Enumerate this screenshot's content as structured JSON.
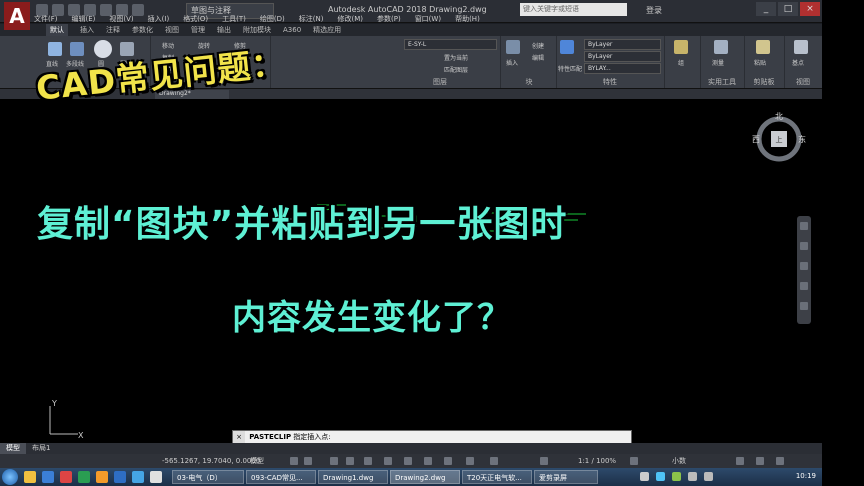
{
  "title_bar": {
    "workspace": "草图与注释",
    "title": "Autodesk AutoCAD 2018    Drawing2.dwg",
    "search_placeholder": "键入关键字或短语",
    "login": "登录",
    "min": "_",
    "max": "□",
    "close": "×",
    "logo": "A"
  },
  "menu": [
    "文件(F)",
    "编辑(E)",
    "视图(V)",
    "插入(I)",
    "格式(O)",
    "工具(T)",
    "绘图(D)",
    "标注(N)",
    "修改(M)",
    "参数(P)",
    "窗口(W)",
    "帮助(H)"
  ],
  "ribbon_tabs": [
    "默认",
    "插入",
    "注释",
    "参数化",
    "视图",
    "管理",
    "输出",
    "附加模块",
    "A360",
    "精选应用"
  ],
  "ribbon": {
    "draw": {
      "line": "直线",
      "polyline": "多段线",
      "circle": "圆",
      "arc": "圆弧"
    },
    "modify": {
      "move": "移动",
      "rotate": "旋转",
      "copy": "复制",
      "mirror": "镜像",
      "stretch": "拉伸",
      "trim": "修剪"
    },
    "layer_combo": "E-SY-L",
    "layer_tools": [
      "置为当前",
      "匹配图层"
    ],
    "block": {
      "insert": "插入",
      "create": "创建",
      "edit": "编辑"
    },
    "properties": {
      "match": "特性匹配",
      "bylayer_color": "ByLayer",
      "bylayer_line": "ByLayer",
      "bylayer_weight": "BYLAY..."
    },
    "groups": "组",
    "measure": "测量",
    "paste": "粘贴",
    "base": "基点",
    "panels": [
      "图层",
      "块",
      "特性",
      "实用工具",
      "剪贴板",
      "视图"
    ]
  },
  "doc_tab": "Drawing2*",
  "viewcube": {
    "north": "北",
    "east": "东",
    "west": "西",
    "top": "上"
  },
  "headlines": {
    "line1": "CAD常见问题：",
    "line2": "复制“图块”并粘贴到另一张图时",
    "line3": "内容发生变化了？"
  },
  "ucs": {
    "y": "Y",
    "x": "X"
  },
  "command": {
    "close": "×",
    "name": "PASTECLIP",
    "prompt": "指定插入点:"
  },
  "layout_tabs": [
    "模型",
    "布局1"
  ],
  "status": {
    "coords": "-565.1267, 19.7040, 0.0000",
    "mode": "模型",
    "scale": "1:1 / 100%",
    "units": "小数"
  },
  "taskbar": {
    "tasks": [
      "03-电气（D）",
      "093-CAD常见...",
      "Drawing1.dwg",
      "Drawing2.dwg",
      "T20天正电气软...",
      "爱剪录屏"
    ],
    "clock": "10:19"
  },
  "colors": {
    "headline_yellow": "#f1e34a",
    "headline_cyan": "#5ef0d4",
    "drawing_green": "#19c93a",
    "canvas": "#000000"
  }
}
